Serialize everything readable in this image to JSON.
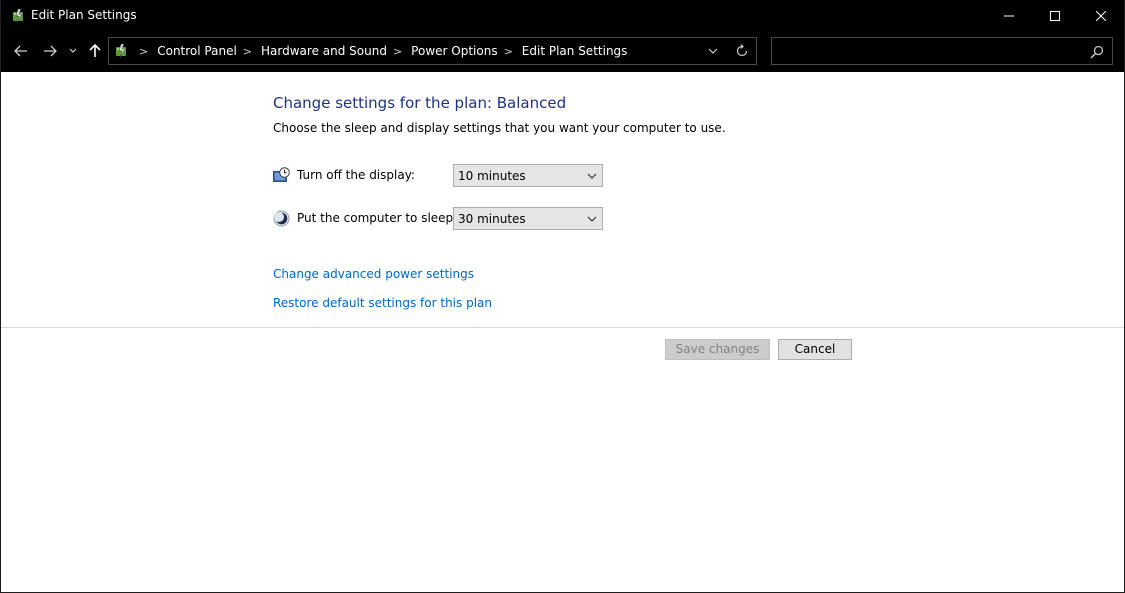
{
  "window": {
    "title": "Edit Plan Settings",
    "icon": "power-options-icon",
    "controls": [
      "minimize-icon",
      "maximize-icon",
      "close-icon"
    ]
  },
  "navigation": {
    "icons": [
      "back-arrow-icon",
      "forward-arrow-icon",
      "recent-locations-chevron-icon",
      "up-arrow-icon"
    ]
  },
  "address_bar": {
    "icon": "control-panel-icon",
    "crumbs": [
      "Control Panel",
      "Hardware and Sound",
      "Power Options",
      "Edit Plan Settings"
    ],
    "separator": ">"
  },
  "search": {
    "value": "",
    "placeholder": ""
  },
  "main": {
    "heading": "Change settings for the plan: Balanced",
    "subtext": "Choose the sleep and display settings that you want your computer to use.",
    "settings": [
      {
        "label": "Turn off the display:",
        "value": "10 minutes",
        "icon": "display-timer-icon"
      },
      {
        "label": "Put the computer to sleep:",
        "value": "30 minutes",
        "icon": "sleep-moon-icon"
      }
    ],
    "links": {
      "advanced": "Change advanced power settings",
      "restore": "Restore default settings for this plan"
    },
    "buttons": {
      "save": "Save changes",
      "cancel": "Cancel"
    }
  },
  "colors": {
    "titlebar": "#000000",
    "heading": "#1e3287",
    "link": "#0066cc",
    "disabled_text": "#838383"
  }
}
